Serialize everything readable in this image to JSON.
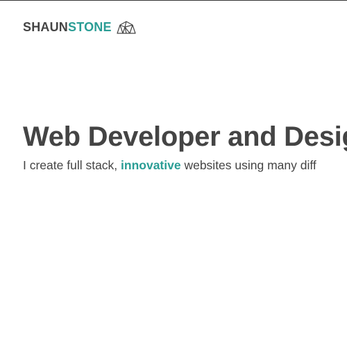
{
  "brand": {
    "part1": "SHAUN",
    "part2": "STONE",
    "icon": "house-logo-icon",
    "accent_color": "#2a9d95"
  },
  "hero": {
    "title": "Web Developer and Design",
    "subtitle_before": "I create full stack, ",
    "subtitle_highlight": "innovative",
    "subtitle_after": " websites using many diff"
  }
}
